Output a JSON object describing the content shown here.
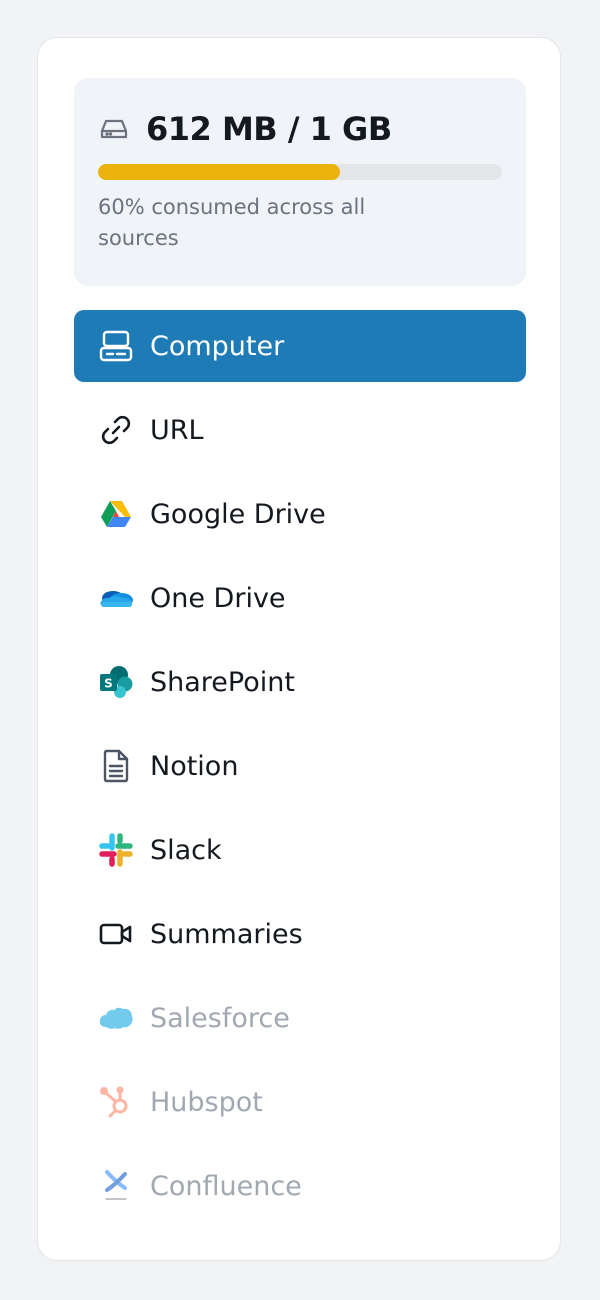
{
  "storage": {
    "title": "612 MB / 1 GB",
    "used_fraction": 0.6,
    "caption": "60% consumed across all sources",
    "bar_color": "#ecb20e",
    "icon": "hard-drive-icon"
  },
  "sources": [
    {
      "label": "Computer",
      "icon": "computer-icon",
      "active": true,
      "disabled": false
    },
    {
      "label": "URL",
      "icon": "link-icon",
      "active": false,
      "disabled": false
    },
    {
      "label": "Google Drive",
      "icon": "google-drive-icon",
      "active": false,
      "disabled": false
    },
    {
      "label": "One Drive",
      "icon": "onedrive-icon",
      "active": false,
      "disabled": false
    },
    {
      "label": "SharePoint",
      "icon": "sharepoint-icon",
      "active": false,
      "disabled": false
    },
    {
      "label": "Notion",
      "icon": "document-icon",
      "active": false,
      "disabled": false
    },
    {
      "label": "Slack",
      "icon": "slack-icon",
      "active": false,
      "disabled": false
    },
    {
      "label": "Summaries",
      "icon": "video-camera-icon",
      "active": false,
      "disabled": false
    },
    {
      "label": "Salesforce",
      "icon": "salesforce-icon",
      "active": false,
      "disabled": true
    },
    {
      "label": "Hubspot",
      "icon": "hubspot-icon",
      "active": false,
      "disabled": true
    },
    {
      "label": "Confluence",
      "icon": "confluence-icon",
      "active": false,
      "disabled": true
    }
  ],
  "colors": {
    "active_bg": "#1f7bb6",
    "text": "#14181f",
    "disabled_text": "#a2a8b2"
  }
}
